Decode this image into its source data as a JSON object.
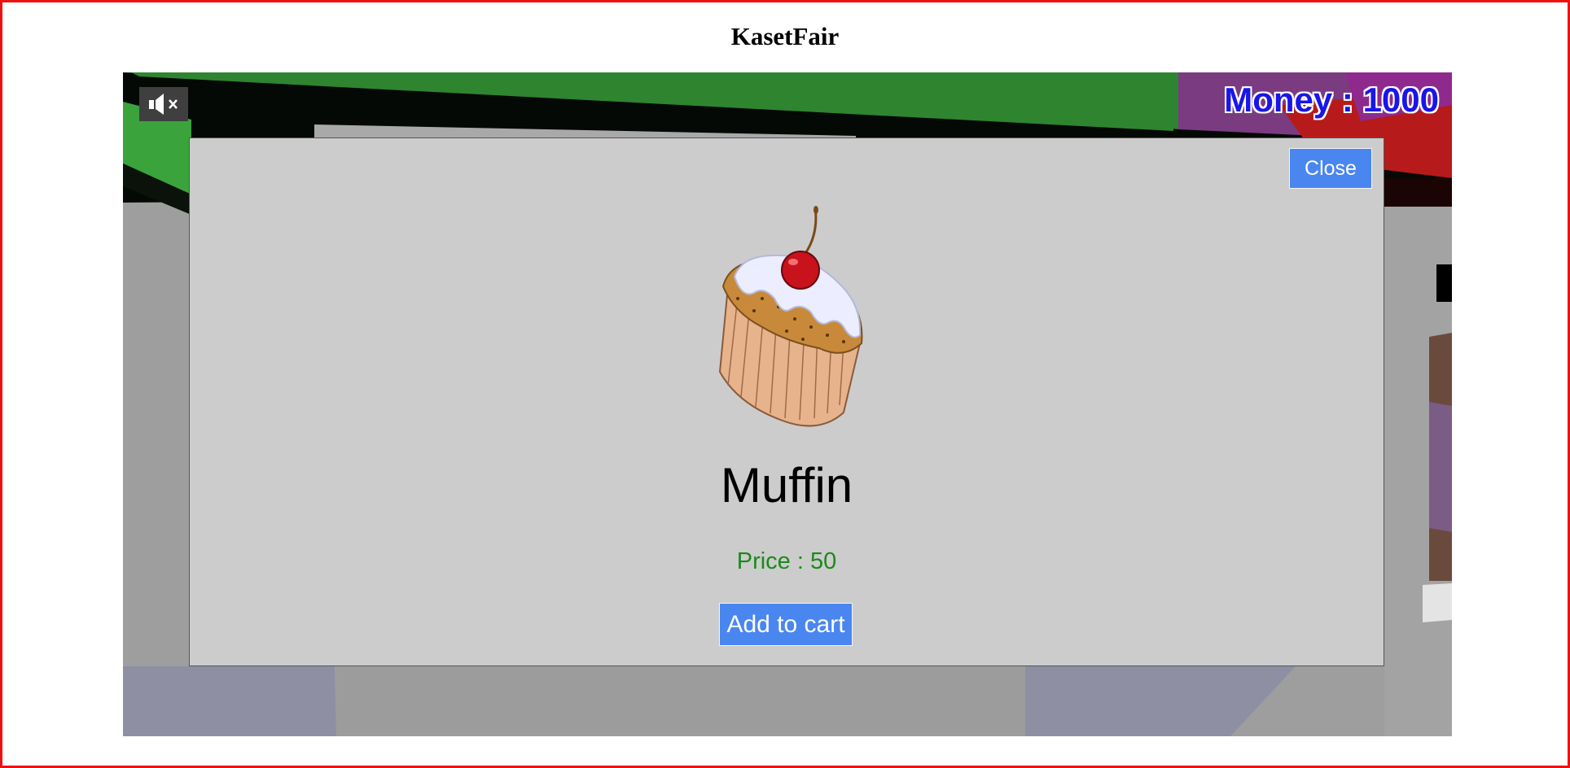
{
  "page": {
    "title": "KasetFair"
  },
  "hud": {
    "mute_icon": "speaker-muted-icon",
    "money_label": "Money",
    "money_separator": " : ",
    "money_value": "1000"
  },
  "modal": {
    "close_label": "Close",
    "image_icon": "muffin-icon",
    "item_name": "Muffin",
    "price_label": "Price : ",
    "price_value": "50",
    "add_to_cart_label": "Add to cart"
  },
  "colors": {
    "frame_border": "#ee1111",
    "button_bg": "#4a86f0",
    "money_text": "#1a16e6",
    "price_text": "#1b8a1b",
    "modal_bg": "#cccccc"
  }
}
